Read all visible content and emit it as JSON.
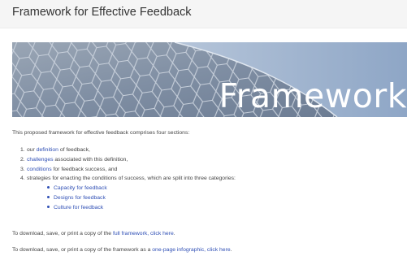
{
  "page_title": "Framework for Effective Feedback",
  "banner": {
    "word": "Framework"
  },
  "intro": "This proposed framework for effective feedback comprises four sections:",
  "sections": [
    {
      "num": "1.",
      "pre": "our ",
      "link": "definition",
      "post": " of feedback,"
    },
    {
      "num": "2.",
      "pre": "",
      "link": "challenges",
      "post": " associated with this definition,"
    },
    {
      "num": "3.",
      "pre": "",
      "link": "conditions",
      "post": " for feedback success, and"
    },
    {
      "num": "4.",
      "pre": "strategies for enacting the conditions of success, which are split into three categories:",
      "link": "",
      "post": ""
    }
  ],
  "categories": [
    "Capacity for feedback",
    "Designs for feedback",
    "Culture for feedback"
  ],
  "download1": {
    "pre": "To download, save, or print a copy of the ",
    "link": "full framework, click here",
    "post": "."
  },
  "download2": {
    "pre": "To download, save, or print a copy of the framework as a ",
    "link": "one-page infographic, click here",
    "post": "."
  },
  "colors": {
    "link": "#2f4fb5",
    "header_bg": "#f5f5f5",
    "banner_sky": "#9fb3cf"
  }
}
